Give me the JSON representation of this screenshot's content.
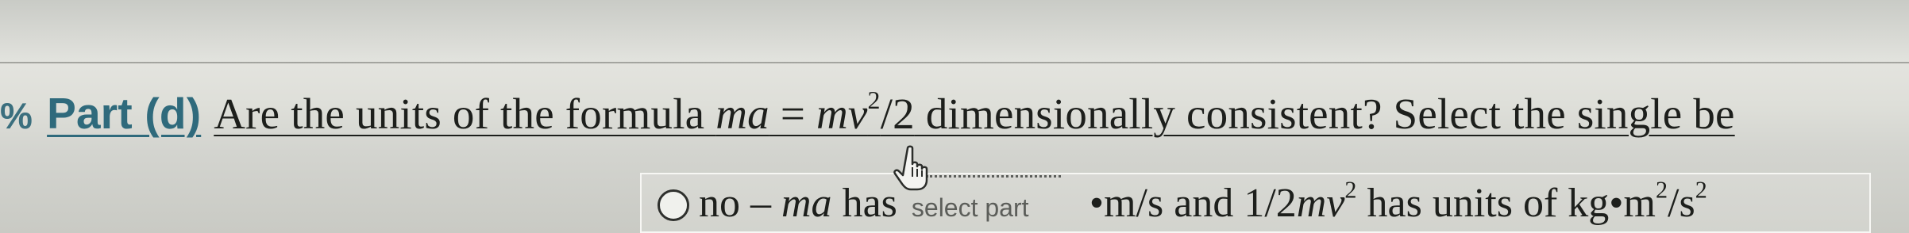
{
  "question": {
    "bullet": "%",
    "part_label": "Part (d)",
    "prefix": "Are the units of the formula ",
    "formula_lhs": "ma",
    "formula_eq": " = ",
    "formula_rhs_base": "mv",
    "formula_rhs_exp": "2",
    "formula_rhs_tail": "/2",
    "suffix": " dimensionally consistent? Select the single be"
  },
  "answer_option": {
    "selected": false,
    "lead": "no – ",
    "ma": "ma",
    "has": " has",
    "select_placeholder": "select part",
    "units_lhs": "m/s and 1/2",
    "mv": "mv",
    "mv_exp": "2",
    "mid": " has units of kg",
    "dot": "•",
    "m": "m",
    "m_exp": "2",
    "slash_s": "/s",
    "s_exp": "2"
  },
  "icons": {
    "cursor": "hand-pointer-icon",
    "bullet": "expand-bullet-icon"
  }
}
